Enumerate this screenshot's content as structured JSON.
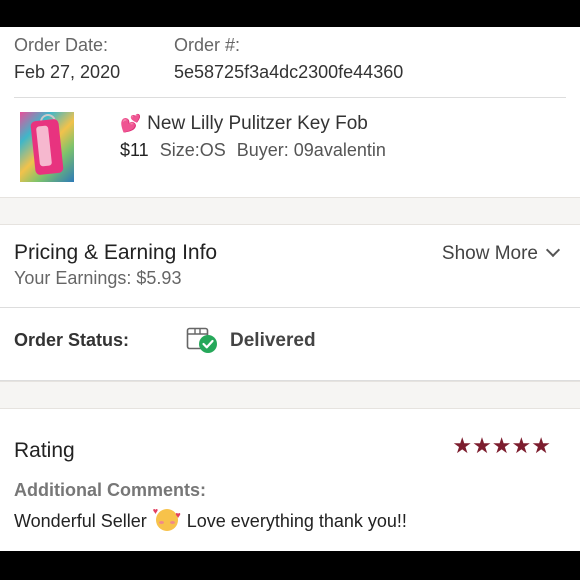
{
  "order": {
    "date_label": "Order Date:",
    "date_value": "Feb 27, 2020",
    "number_label": "Order #:",
    "number_value": "5e58725f3a4dc2300fe44360"
  },
  "product": {
    "icon": "two-hearts-emoji",
    "title": "New Lilly Pulitzer Key Fob",
    "price": "$11",
    "size": "Size:OS",
    "buyer": "Buyer: 09avalentin"
  },
  "pricing": {
    "title": "Pricing & Earning Info",
    "earnings": "Your Earnings: $5.93",
    "show_more": "Show More"
  },
  "status": {
    "label": "Order Status:",
    "value": "Delivered",
    "icon": "delivered-box-check-icon"
  },
  "rating": {
    "label": "Rating",
    "stars": 5,
    "max": 5,
    "star_color": "#7c1d2e"
  },
  "comments": {
    "label": "Additional Comments:",
    "text_before": "Wonderful Seller",
    "emoji": "smiling-face-with-hearts",
    "text_after": "Love everything thank you!!"
  }
}
